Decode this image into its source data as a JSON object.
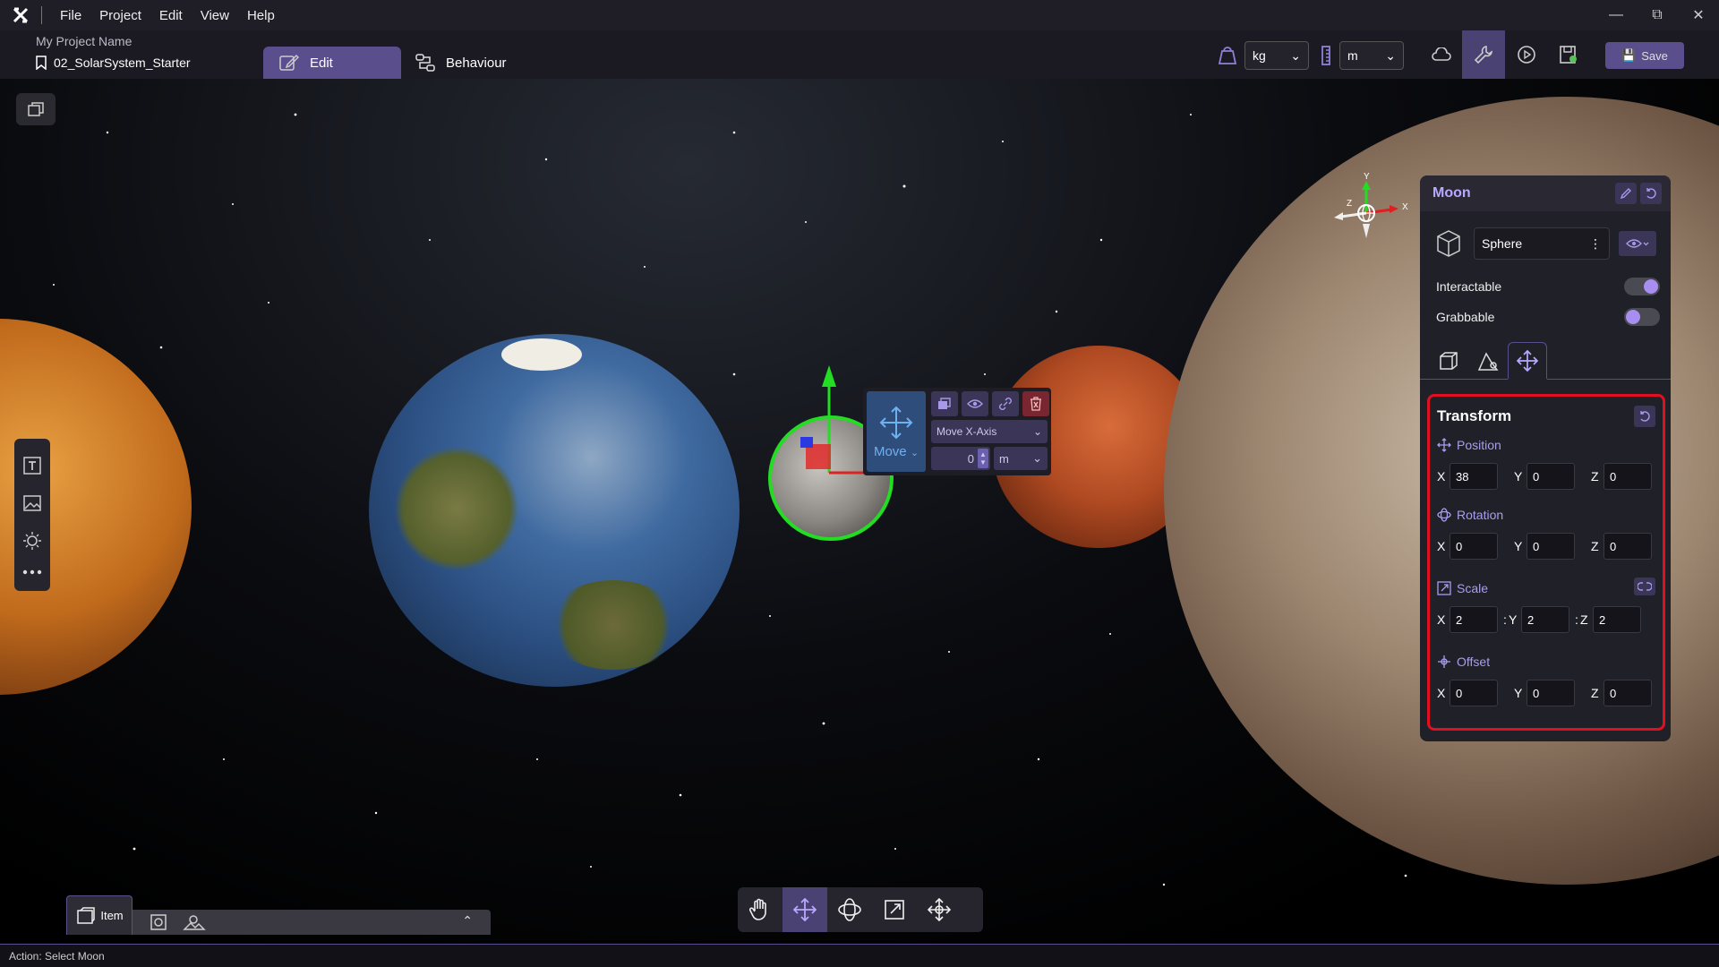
{
  "menubar": {
    "items": [
      "File",
      "Project",
      "Edit",
      "View",
      "Help"
    ]
  },
  "header": {
    "project_name": "My Project Name",
    "scene_name": "02_SolarSystem_Starter",
    "tab_edit": "Edit",
    "tab_behaviour": "Behaviour",
    "mass_unit": "kg",
    "length_unit": "m",
    "save_label": "Save"
  },
  "popup": {
    "move_label": "Move",
    "axis": "Move X-Axis",
    "value": "0",
    "unit": "m"
  },
  "bottom": {
    "item_tab": "Item"
  },
  "status": {
    "action": "Action: Select Moon"
  },
  "gizmo": {
    "y": "Y",
    "x": "X",
    "z": "Z"
  },
  "inspector": {
    "title": "Moon",
    "shape": "Sphere",
    "interactable_label": "Interactable",
    "interactable_on": true,
    "grabbable_label": "Grabbable",
    "grabbable_on": false,
    "transform": {
      "title": "Transform",
      "position_label": "Position",
      "rotation_label": "Rotation",
      "scale_label": "Scale",
      "offset_label": "Offset",
      "position": {
        "x": "38",
        "y": "0",
        "z": "0"
      },
      "rotation": {
        "x": "0",
        "y": "0",
        "z": "0"
      },
      "scale": {
        "x": "2",
        "y": "2",
        "z": "2"
      },
      "offset": {
        "x": "0",
        "y": "0",
        "z": "0"
      }
    }
  },
  "colors": {
    "accent": "#5a4f8c",
    "accent_light": "#a99cf0",
    "highlight": "#e01020",
    "selection": "#22dd22"
  }
}
